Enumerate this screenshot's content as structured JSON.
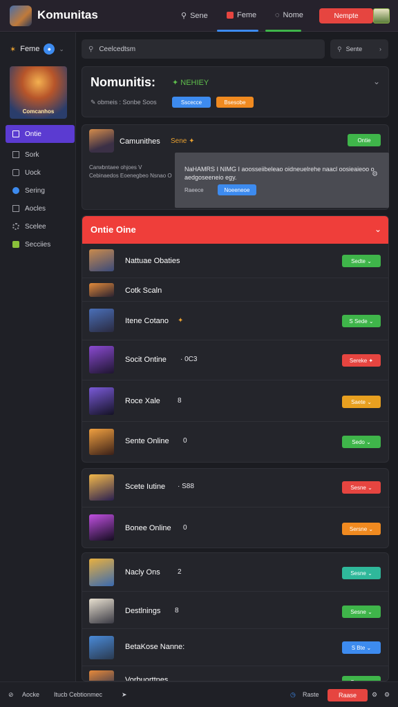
{
  "app": {
    "title": "Komunitas"
  },
  "nav": {
    "items": [
      {
        "label": "Sene",
        "icon": "search-icon"
      },
      {
        "label": "Feme",
        "icon": "flame-icon"
      },
      {
        "label": "Nome",
        "icon": "chat-icon"
      }
    ],
    "cta_label": "Nempte"
  },
  "sidebar": {
    "header": "Feme",
    "badge": "●",
    "hero_label": "Comcanhos",
    "items": [
      {
        "label": "Ontie",
        "icon": "home-icon",
        "active": true
      },
      {
        "label": "Sork",
        "icon": "box-icon"
      },
      {
        "label": "Uock",
        "icon": "lock-icon"
      },
      {
        "label": "Sering",
        "icon": "circle-icon"
      },
      {
        "label": "Aocles",
        "icon": "article-icon"
      },
      {
        "label": "Scelee",
        "icon": "gear-icon"
      },
      {
        "label": "Secciies",
        "icon": "puzzle-icon"
      }
    ]
  },
  "search": {
    "placeholder": "Ceelcedtsm"
  },
  "sort": {
    "label": "Sente"
  },
  "hero": {
    "title": "Nomunitis:",
    "tag": "✦ NEHIEY",
    "subtitle": "✎ obmeis : Sonbe Soos",
    "pill_blue": "Sscecce",
    "pill_orange": "Bsesobe"
  },
  "post": {
    "name": "Camunithes",
    "extra": "Sene ✦",
    "button": "Ontie",
    "text": "Carwbntaee ohjoes V Cebinaedos Eoenegbeo Nsnao O",
    "tooltip_title": "NaHAMRS I NIMG I aoosseiibeleao oidneuelrehe naacl oosieaieoo o aedgoseeneio egy.",
    "tooltip_label": "Raeece",
    "tooltip_button": "Noeeneoe"
  },
  "online": {
    "title": "Ontie Oine",
    "rows": [
      {
        "name": "Nattuae Obaties",
        "extra": "",
        "button": "Sedte ⌄",
        "btn_color": "#3fb54a",
        "avatar": "linear-gradient(160deg,#c98a4c,#3a4a7a)"
      },
      {
        "name": "Cotk Scaln",
        "extra": "",
        "button": "",
        "btn_color": "",
        "avatar": "linear-gradient(160deg,#e28a3a,#2a2230)"
      },
      {
        "name": "Itene Cotano",
        "extra": "✦",
        "button": "S Sede ⌄",
        "btn_color": "#3fb54a",
        "avatar": "linear-gradient(160deg,#4a6fb8,#2a2a40)"
      },
      {
        "name": "Socit Ontine",
        "extra": "· 0C3",
        "button": "Sereke ✦",
        "btn_color": "#e64540",
        "avatar": "linear-gradient(160deg,#8a4ad1,#1e1530)"
      },
      {
        "name": "Roce Xale",
        "extra": "8",
        "button": "Saete ⌄",
        "btn_color": "#e8a020",
        "avatar": "linear-gradient(160deg,#7a5ad8,#141225)"
      },
      {
        "name": "Sente Online",
        "extra": "0",
        "button": "Sedo ⌄",
        "btn_color": "#3fb54a",
        "avatar": "linear-gradient(160deg,#f0a040,#3a2018)"
      }
    ]
  },
  "group2": {
    "rows": [
      {
        "name": "Scete Iutine",
        "extra": "· S88",
        "button": "Sesne ⌄",
        "btn_color": "#e64540",
        "avatar": "linear-gradient(160deg,#f2b84a,#2a2050)"
      },
      {
        "name": "Bonee Online",
        "extra": "0",
        "button": "Sersne ⌄",
        "btn_color": "#f08a20",
        "avatar": "linear-gradient(160deg,#c050e0,#140c20)"
      }
    ]
  },
  "group3": {
    "rows": [
      {
        "name": "Nacly Ons",
        "extra": "2",
        "button": "Sesne ⌄",
        "btn_color": "#2fb89a",
        "avatar": "linear-gradient(160deg,#e8b040,#3a6ab0)"
      },
      {
        "name": "Destlnings",
        "extra": "8",
        "button": "Sesne ⌄",
        "btn_color": "#3fb54a",
        "avatar": "linear-gradient(160deg,#e8e0d0,#3a3a44)"
      },
      {
        "name": "BetaKose Nanne:",
        "extra": "",
        "button": "S Bte ⌄",
        "btn_color": "#3d8bef",
        "avatar": "linear-gradient(160deg,#4a8ad8,#2a3a50)"
      },
      {
        "name": "Vorbuorttnes",
        "extra": "",
        "button": "Sesne ⌄",
        "btn_color": "#3fb54a",
        "avatar": "linear-gradient(160deg,#e88a3a,#1a2a50)"
      }
    ]
  },
  "bottombar": {
    "left_label": "Aocke",
    "left_text": "Itucb Cebtionmec",
    "right_label": "Raste",
    "right_button": "Raase"
  },
  "colors": {
    "accent": "#5b3bd1",
    "danger": "#ef3e3a",
    "success": "#3fb54a"
  }
}
